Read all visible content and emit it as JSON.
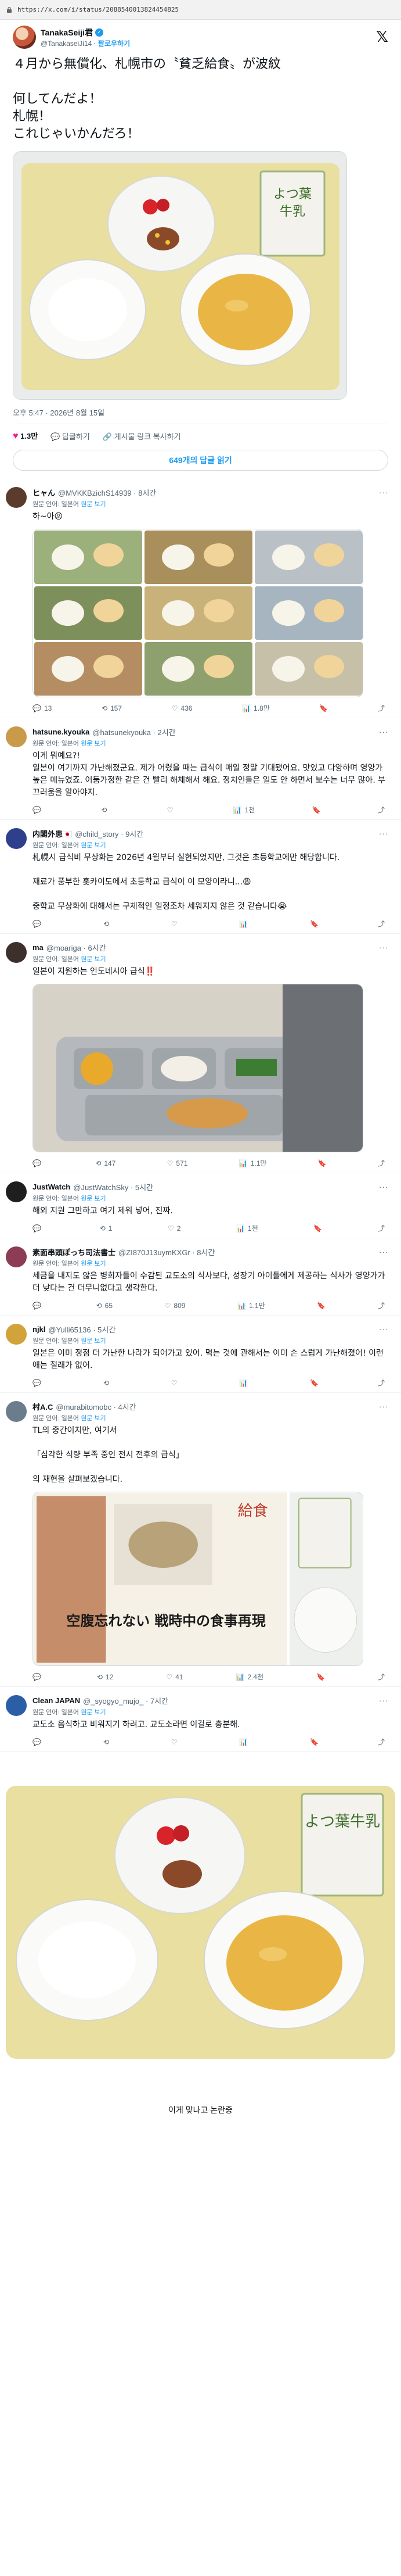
{
  "browser": {
    "url": "https://x.com/i/status/2088540013824454825"
  },
  "main": {
    "name": "TanakaSeiji君",
    "handle": "@TanakaseiJi14",
    "translate_label": "· 팔로우하기",
    "text": "４月から無償化、札幌市の〝貧乏給食〟が波紋\n\n何してんだよ！\n札幌！\nこれじゃいかんだろ！",
    "meta": "오후 5:47 · 2026년 8월 15일",
    "likes": "1.3만",
    "reply_label": "답글하기",
    "copy_label": "게시물 링크 복사하기",
    "read_replies": "649개의 답글 읽기"
  },
  "replies": [
    {
      "name": "ヒャん",
      "handle": "@MVKKBzichS14939 · 8시간",
      "trans": "원문 언어: 일본어",
      "trans_link": "원문 보기",
      "text": "하~아😡",
      "stats": {
        "reply": "13",
        "retweet": "157",
        "like": "436",
        "view": "1.8만"
      }
    },
    {
      "name": "hatsune.kyouka",
      "handle": "@hatsunekyouka · 2시간",
      "trans": "원문 언어: 일본어",
      "trans_link": "원문 보기",
      "text": "이게 뭐예요?!\n일본이 여기까지 가난해졌군요. 제가 어렸을 때는 급식이 매일 정말 기대됐어요. 맛있고 다양하며 영양가 높은 메뉴였죠. 어둠가정한 같은 건 빨리 해체해서 해요. 정치인들은 일도 안 하면서 보수는 너무 많아. 부끄러움을 알아야지.",
      "stats": {
        "reply": "",
        "retweet": "",
        "like": "",
        "view": "1천"
      }
    },
    {
      "name": "内閣外患🇯🇵",
      "handle": "@child_story · 9시간",
      "trans": "원문 언어: 일본어",
      "trans_link": "원문 보기",
      "text": "札幌시 급식비 무상화는 2026년 4월부터 실현되었지만, 그것은 초등학교에만 해당합니다.\n\n재료가 풍부한 홋카이도에서 초등학교 급식이 이 모양이라니...😩\n\n중학교 무상화에 대해서는 구체적인 일정조차 세워지지 않은 것 같습니다😭",
      "stats": {
        "reply": "",
        "retweet": "",
        "like": "",
        "view": ""
      }
    },
    {
      "name": "ma",
      "handle": "@moariga · 6시간",
      "trans": "원문 언어: 일본어",
      "trans_link": "원문 보기",
      "text": "일본이 지원하는 인도네시아 급식‼️",
      "stats": {
        "reply": "",
        "retweet": "147",
        "like": "571",
        "view": "1.1만"
      }
    },
    {
      "name": "JustWatch",
      "handle": "@JustWatchSky · 5시간",
      "trans": "원문 언어: 일본어",
      "trans_link": "원문 보기",
      "text": "해외 지원 그만하고 여기 제워 넣어, 진짜.",
      "stats": {
        "reply": "",
        "retweet": "1",
        "like": "2",
        "view": "1천"
      }
    },
    {
      "name": "素面串頭ぽっち司法書士",
      "handle": "@ZI870J13uymKXGr · 8시간",
      "trans": "원문 언어: 일본어",
      "trans_link": "원문 보기",
      "text": "세금을 내지도 않은 병희자들이 수감된 교도소의 식사보다, 성장기 아이들에게 제공하는 식사가 영양가가 더 낮다는 건 더무니없다고 생각한다.",
      "stats": {
        "reply": "",
        "retweet": "65",
        "like": "809",
        "view": "1.1만"
      }
    },
    {
      "name": "njkl",
      "handle": "@Yulli65136 · 5시간",
      "trans": "원문 언어: 일본어",
      "trans_link": "원문 보기",
      "text": "일본은 이미 정점 더 가난한 나라가 되어가고 있어. 먹는 것에 관해서는 이미 손 스럽게 가난해졌어! 이런 애는 절래가 없어.",
      "stats": {
        "reply": "",
        "retweet": "",
        "like": "",
        "view": ""
      }
    },
    {
      "name": "村A.C",
      "handle": "@murabitomobc · 4시간",
      "trans": "원문 언어: 일본어",
      "trans_link": "원문 보기",
      "text": "TL의 중간이지만, 여기서\n\n「심각한 식량 부족 중인 전시 전후의 급식」\n\n의 재현을 살펴보겠습니다.",
      "stats": {
        "reply": "",
        "retweet": "12",
        "like": "41",
        "view": "2.4천"
      }
    },
    {
      "name": "Clean JAPAN",
      "handle": "@_syogyo_mujo_ · 7시간",
      "trans": "원문 언어: 일본어",
      "trans_link": "원문 보기",
      "text": "교도소 음식하고 비워지기 하려고. 교도소라면 이걸로 충분해.",
      "stats": {
        "reply": "",
        "retweet": "",
        "like": "",
        "view": ""
      }
    }
  ],
  "news_clip": {
    "headline": "空腹忘れない 戦時中の食事再現",
    "tag": "給食",
    "milk": "よつ葉牛乳"
  },
  "ending": "이게 맞나고 논란중",
  "colors": {
    "accent": "#1d9bf0",
    "like": "#f91880",
    "tray": "#e8dfa0"
  }
}
